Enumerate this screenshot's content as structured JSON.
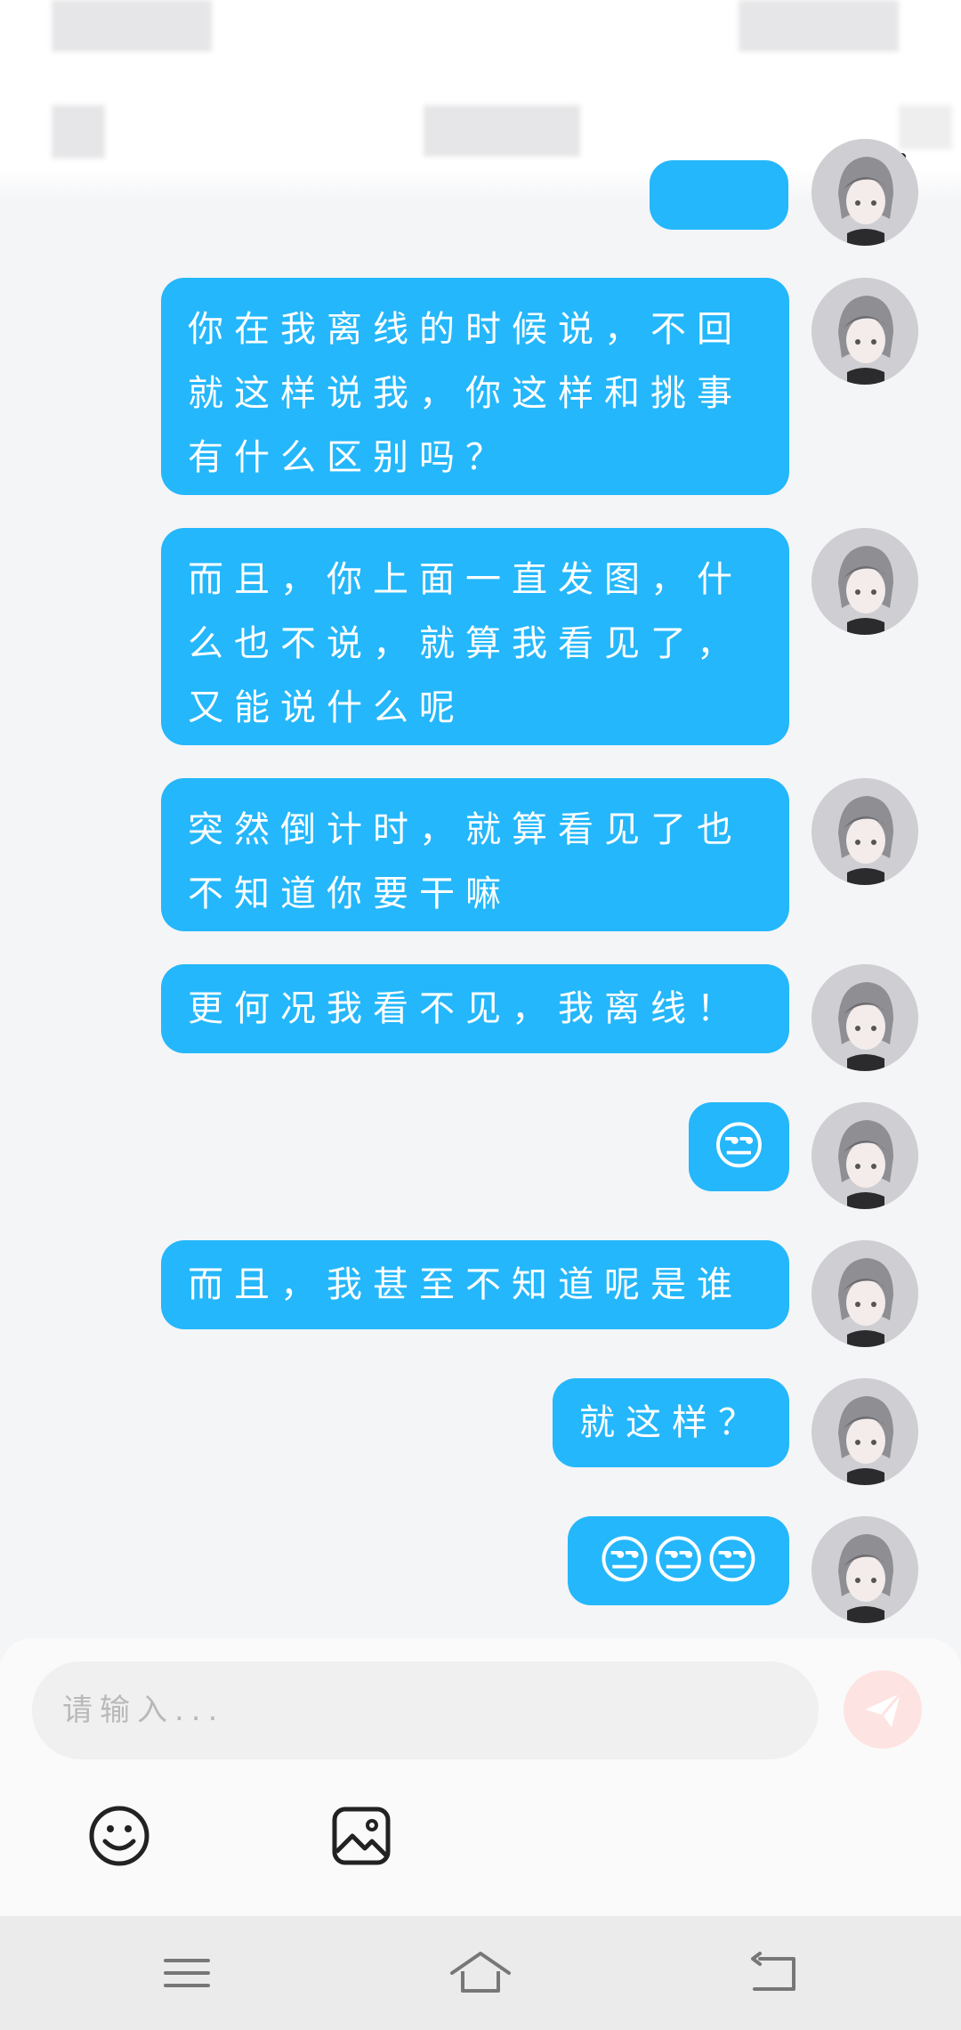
{
  "messages": [
    {
      "text": "你在我离线的时候说，不回就这样说我，你这样和挑事有什么区别吗？",
      "type": "text"
    },
    {
      "text": "而且，你上面一直发图，什么也不说，就算我看见了，又能说什么呢",
      "type": "text"
    },
    {
      "text": "突然倒计时，就算看见了也不知道你要干嘛",
      "type": "text"
    },
    {
      "text": "更何况我看不见，我离线！",
      "type": "text"
    },
    {
      "text": "😒",
      "type": "emoji"
    },
    {
      "text": "而且，我甚至不知道呢是谁",
      "type": "text"
    },
    {
      "text": "就这样？",
      "type": "text"
    },
    {
      "text": "😒😒😒",
      "type": "emoji"
    }
  ],
  "composer": {
    "placeholder": "请输入..."
  },
  "icons": {
    "send": "send-icon",
    "emoji": "emoji-icon",
    "image": "image-icon",
    "nav_menu": "menu-icon",
    "nav_home": "home-icon",
    "nav_back": "back-icon"
  },
  "colors": {
    "bubble": "#24b7fb",
    "background": "#f4f5f7",
    "send_button": "#fde3e1"
  }
}
